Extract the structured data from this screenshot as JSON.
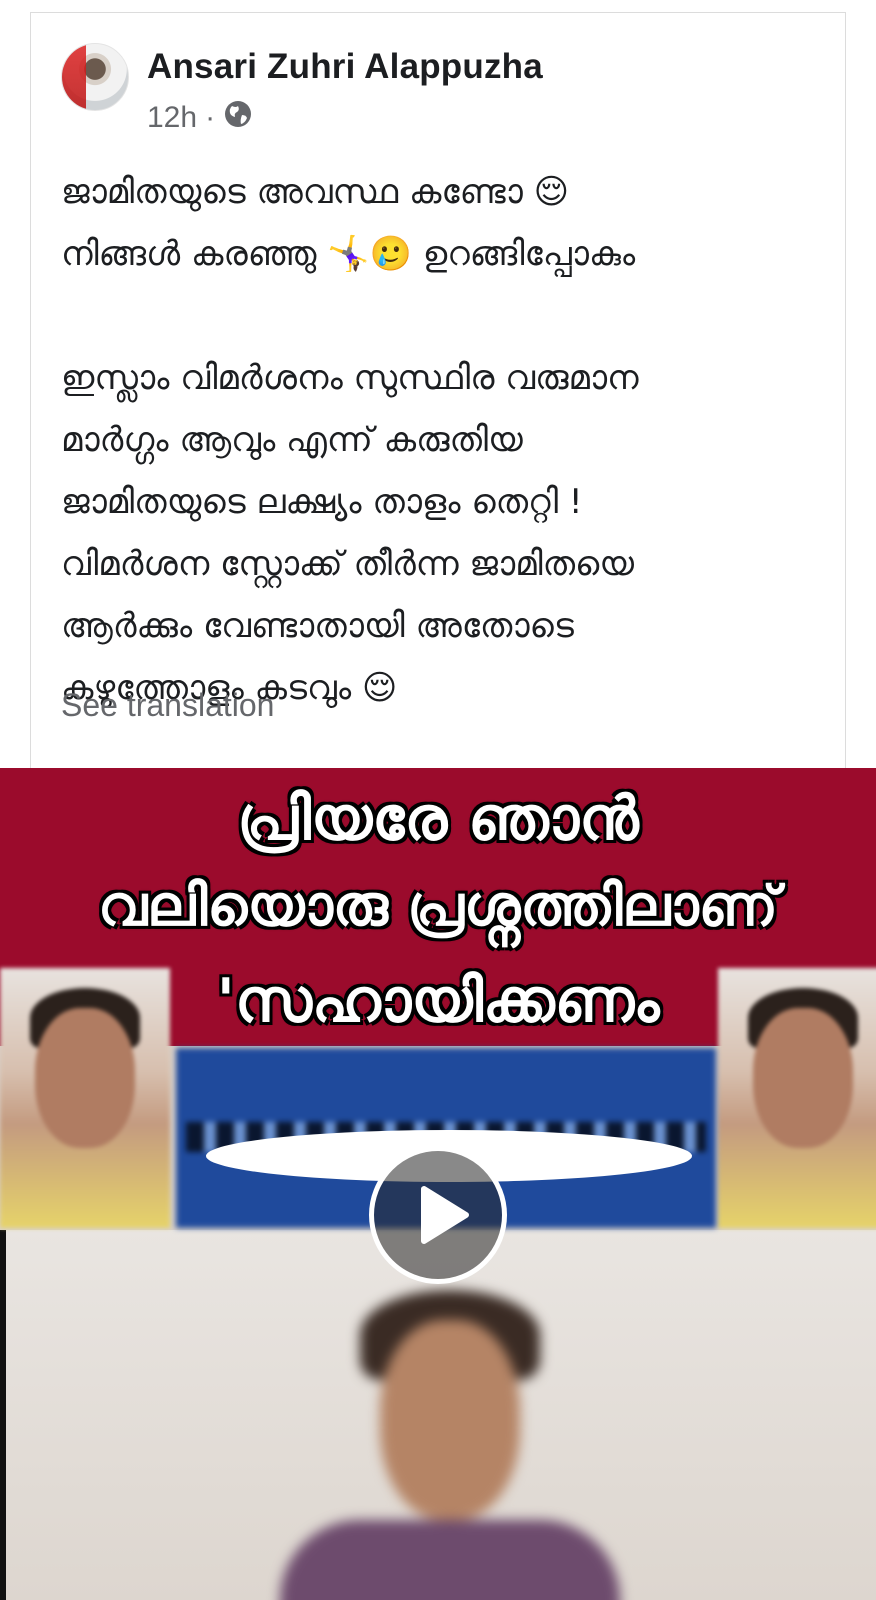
{
  "post": {
    "author": "Ansari Zuhri Alappuzha",
    "time": "12h",
    "separator": "·",
    "audience_icon": "globe-icon",
    "text_lines_1": [
      "ജാമിതയുടെ അവസ്ഥ കണ്ടോ 😌",
      "നിങ്ങൾ കരഞ്ഞു 🤸‍♀️🥲 ഉറങ്ങിപ്പോകും"
    ],
    "text_lines_2": [
      "ഇസ്ലാം വിമർശനം സുസ്ഥിര വരുമാന",
      "മാർഗ്ഗം ആവും എന്ന് കരുതിയ",
      "ജാമിതയുടെ ലക്ഷ്യം താളം തെറ്റി !",
      "വിമർശന സ്റ്റോക്ക് തീർന്ന ജാമിതയെ",
      "ആർക്കും വേണ്ടാതായി അതോടെ",
      "കഴുത്തോളം കടവും 😌"
    ],
    "see_translation": "See translation"
  },
  "video": {
    "banner_lines": [
      "പ്രിയരേ ഞാൻ",
      "വലിയൊരു പ്രശ്നത്തിലാണ്",
      "'സഹായിക്കണം"
    ],
    "banner_color": "#9b0b2c",
    "play_icon": "play-icon"
  }
}
